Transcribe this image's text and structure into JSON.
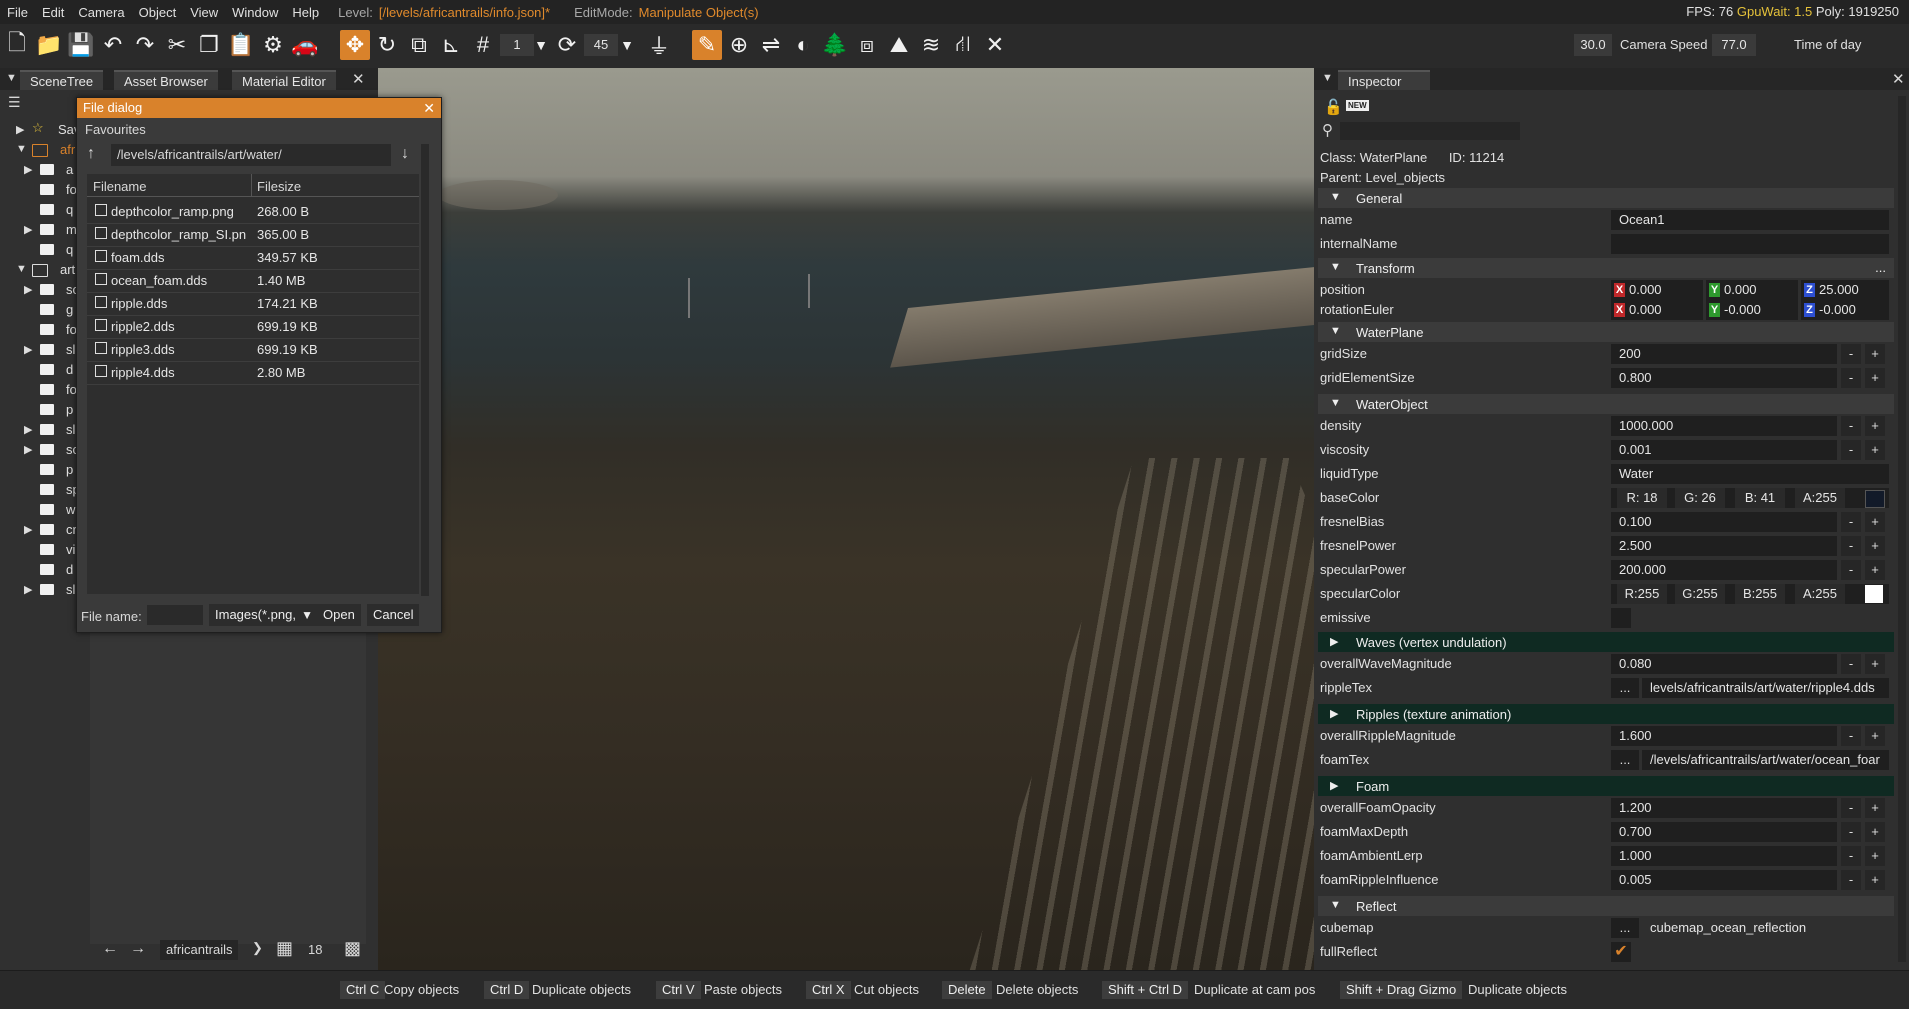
{
  "menubar": {
    "items": [
      "File",
      "Edit",
      "Camera",
      "Object",
      "View",
      "Window",
      "Help"
    ],
    "level_label": "Level:",
    "level_value": "[/levels/africantrails/info.json]*",
    "editmode_label": "EditMode:",
    "editmode_value": "Manipulate Object(s)",
    "fps": "FPS: 76",
    "gpuwait": "GpuWait: 1.5",
    "poly": "Poly: 1919250"
  },
  "toolbar": {
    "grid_value": "1",
    "rotate_value": "45",
    "camera_speed_value": "30.0",
    "camera_speed_label": "Camera Speed",
    "time_of_day_value": "77.0",
    "time_of_day_label": "Time of day"
  },
  "left_tabs": [
    "SceneTree",
    "Asset Browser",
    "Material Editor"
  ],
  "tree": {
    "rows": [
      {
        "label": "Sav"
      },
      {
        "label": "afr"
      },
      {
        "label": "a"
      },
      {
        "label": "fo"
      },
      {
        "label": "q"
      },
      {
        "label": "m"
      },
      {
        "label": "q"
      },
      {
        "label": "art"
      },
      {
        "label": "so"
      },
      {
        "label": "g"
      },
      {
        "label": "fo"
      },
      {
        "label": "sl"
      },
      {
        "label": "d"
      },
      {
        "label": "fo"
      },
      {
        "label": "p"
      },
      {
        "label": "sl"
      },
      {
        "label": "sc"
      },
      {
        "label": "p"
      },
      {
        "label": "sp"
      },
      {
        "label": "w"
      },
      {
        "label": "cr"
      },
      {
        "label": "vi"
      },
      {
        "label": "d"
      },
      {
        "label": "sl"
      }
    ]
  },
  "asset_bottom": {
    "path": "africantrails",
    "count": "18"
  },
  "file_dialog": {
    "title": "File dialog",
    "favourites": "Favourites",
    "path": "/levels/africantrails/art/water/",
    "columns": {
      "name": "Filename",
      "size": "Filesize"
    },
    "files": [
      {
        "name": "depthcolor_ramp.png",
        "size": "268.00 B"
      },
      {
        "name": "depthcolor_ramp_SI.png",
        "size": "365.00 B"
      },
      {
        "name": "foam.dds",
        "size": "349.57 KB"
      },
      {
        "name": "ocean_foam.dds",
        "size": "1.40 MB"
      },
      {
        "name": "ripple.dds",
        "size": "174.21 KB"
      },
      {
        "name": "ripple2.dds",
        "size": "699.19 KB"
      },
      {
        "name": "ripple3.dds",
        "size": "699.19 KB"
      },
      {
        "name": "ripple4.dds",
        "size": "2.80 MB"
      }
    ],
    "filename_label": "File name:",
    "filter": "Images(*.png,",
    "open_label": "Open",
    "cancel_label": "Cancel"
  },
  "inspector": {
    "tab": "Inspector",
    "new_label": "NEW",
    "class_label": "Class:",
    "class_value": "WaterPlane",
    "id_label": "ID:",
    "id_value": "11214",
    "parent_label": "Parent:",
    "parent_value": "Level_objects",
    "sections": {
      "general": "General",
      "transform": "Transform",
      "waterplane": "WaterPlane",
      "waterobject": "WaterObject",
      "waves": "Waves (vertex undulation)",
      "ripples": "Ripples (texture animation)",
      "foam": "Foam",
      "reflect": "Reflect"
    },
    "props": {
      "name": {
        "label": "name",
        "value": "Ocean1"
      },
      "internalName": {
        "label": "internalName",
        "value": ""
      },
      "position": {
        "label": "position",
        "x": "0.000",
        "y": "0.000",
        "z": "25.000"
      },
      "rotationEuler": {
        "label": "rotationEuler",
        "x": "0.000",
        "y": "-0.000",
        "z": "-0.000"
      },
      "gridSize": {
        "label": "gridSize",
        "value": "200"
      },
      "gridElementSize": {
        "label": "gridElementSize",
        "value": "0.800"
      },
      "density": {
        "label": "density",
        "value": "1000.000"
      },
      "viscosity": {
        "label": "viscosity",
        "value": "0.001"
      },
      "liquidType": {
        "label": "liquidType",
        "value": "Water"
      },
      "baseColor": {
        "label": "baseColor",
        "r": "R: 18",
        "g": "G: 26",
        "b": "B: 41",
        "a": "A:255",
        "swatch": "#121a29"
      },
      "fresnelBias": {
        "label": "fresnelBias",
        "value": "0.100"
      },
      "fresnelPower": {
        "label": "fresnelPower",
        "value": "2.500"
      },
      "specularPower": {
        "label": "specularPower",
        "value": "200.000"
      },
      "specularColor": {
        "label": "specularColor",
        "r": "R:255",
        "g": "G:255",
        "b": "B:255",
        "a": "A:255",
        "swatch": "#ffffff"
      },
      "emissive": {
        "label": "emissive"
      },
      "overallWaveMagnitude": {
        "label": "overallWaveMagnitude",
        "value": "0.080"
      },
      "rippleTex": {
        "label": "rippleTex",
        "value": "levels/africantrails/art/water/ripple4.dds"
      },
      "overallRippleMagnitude": {
        "label": "overallRippleMagnitude",
        "value": "1.600"
      },
      "foamTex": {
        "label": "foamTex",
        "value": "/levels/africantrails/art/water/ocean_foar"
      },
      "overallFoamOpacity": {
        "label": "overallFoamOpacity",
        "value": "1.200"
      },
      "foamMaxDepth": {
        "label": "foamMaxDepth",
        "value": "0.700"
      },
      "foamAmbientLerp": {
        "label": "foamAmbientLerp",
        "value": "1.000"
      },
      "foamRippleInfluence": {
        "label": "foamRippleInfluence",
        "value": "0.005"
      },
      "cubemap": {
        "label": "cubemap",
        "value": "cubemap_ocean_reflection"
      },
      "fullReflect": {
        "label": "fullReflect"
      }
    },
    "ellipsis": "...",
    "minus": "-",
    "plus": "+"
  },
  "statusbar": [
    {
      "key": "Ctrl C",
      "desc": "Copy objects"
    },
    {
      "key": "Ctrl D",
      "desc": "Duplicate objects"
    },
    {
      "key": "Ctrl V",
      "desc": "Paste objects"
    },
    {
      "key": "Ctrl X",
      "desc": "Cut objects"
    },
    {
      "key": "Delete",
      "desc": "Delete objects"
    },
    {
      "key": "Shift + Ctrl D",
      "desc": "Duplicate at cam pos"
    },
    {
      "key": "Shift + Drag Gizmo",
      "desc": "Duplicate objects"
    }
  ],
  "colors": {
    "accent": "#d9822b",
    "axis_x": "#c0282a",
    "axis_y": "#2e9a2e",
    "axis_z": "#2d4fd1"
  }
}
